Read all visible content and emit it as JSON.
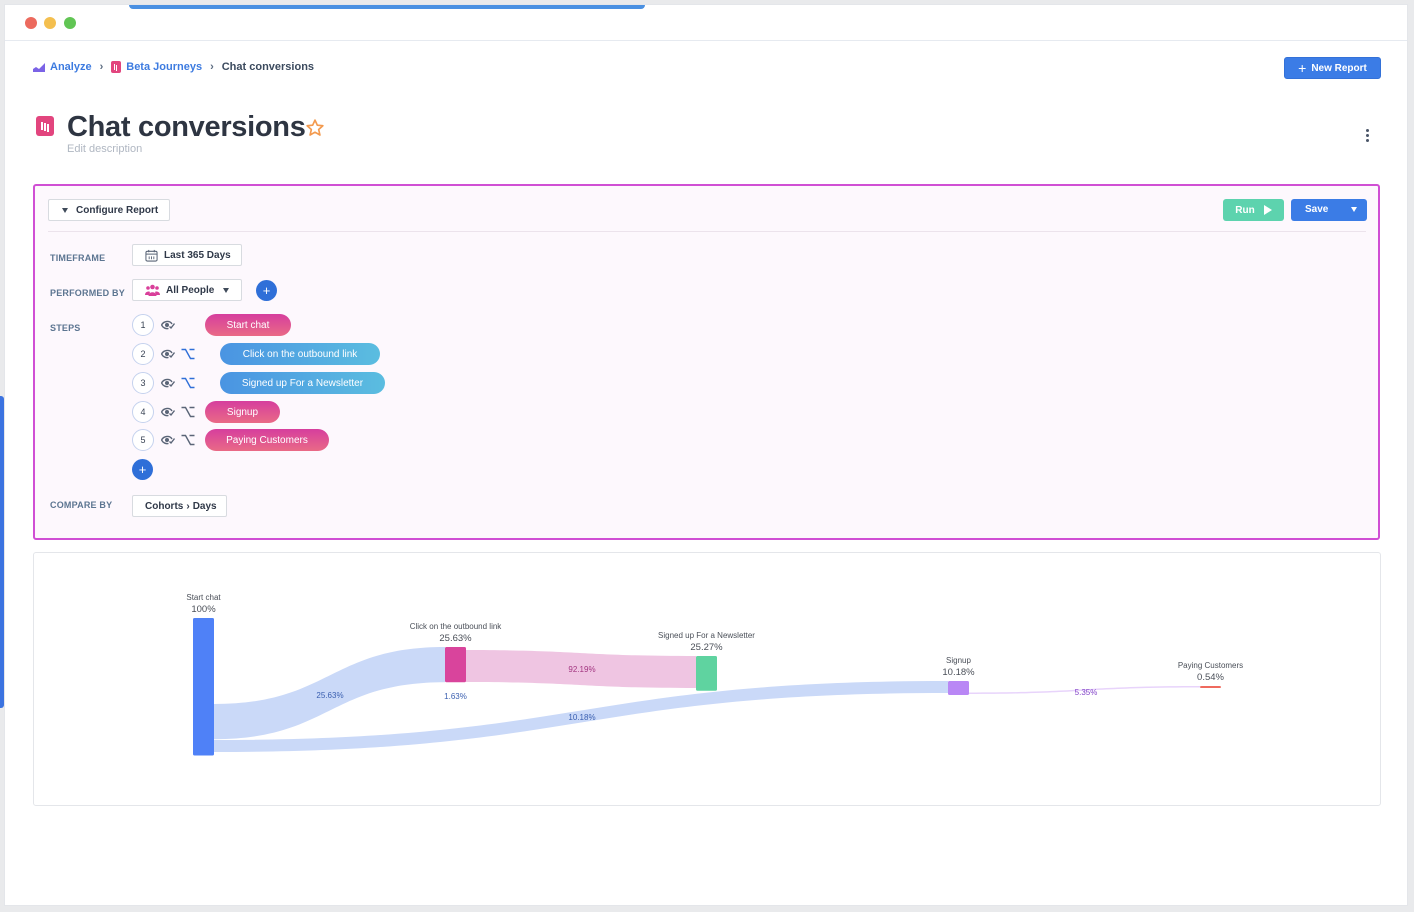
{
  "window": {
    "controls": [
      "close",
      "minimize",
      "maximize"
    ]
  },
  "breadcrumb": {
    "items": [
      {
        "label": "Analyze",
        "icon": "analyze-chart-icon"
      },
      {
        "label": "Beta Journeys",
        "icon": "journey-icon"
      },
      {
        "label": "Chat conversions"
      }
    ],
    "separator": "›"
  },
  "header": {
    "new_report_label": "New Report",
    "new_report_icon": "+",
    "title": "Chat conversions",
    "favorite_icon": "star-outline-icon",
    "description_placeholder": "Edit description",
    "more_icon": "kebab-menu-icon"
  },
  "config": {
    "toggle_label": "Configure Report",
    "run_label": "Run",
    "save_label": "Save",
    "timeframe": {
      "label": "TIMEFRAME",
      "value": "Last 365 Days"
    },
    "performed_by": {
      "label": "PERFORMED BY",
      "value": "All People",
      "add_icon": "+"
    },
    "steps_label": "STEPS",
    "steps": [
      {
        "number": "1",
        "name": "Start chat",
        "color": "pink",
        "has_branch": false
      },
      {
        "number": "2",
        "name": "Click on the outbound link",
        "color": "blue",
        "has_branch": true
      },
      {
        "number": "3",
        "name": "Signed up For a Newsletter",
        "color": "blue",
        "has_branch": true
      },
      {
        "number": "4",
        "name": "Signup",
        "color": "pink",
        "has_branch": true
      },
      {
        "number": "5",
        "name": "Paying Customers",
        "color": "pink",
        "has_branch": true
      }
    ],
    "add_step_icon": "+",
    "compare_by": {
      "label": "COMPARE BY",
      "value_part1": "Cohorts",
      "value_sep": "›",
      "value_part2": "Days"
    }
  },
  "chart_data": {
    "type": "sankey",
    "title": "",
    "nodes": [
      {
        "name": "Start chat",
        "percent_label": "100%",
        "value": 100,
        "color": "#4f81f7"
      },
      {
        "name": "Click on the outbound link",
        "percent_label": "25.63%",
        "value": 25.63,
        "color": "#d9449c"
      },
      {
        "name": "Signed up For a Newsletter",
        "percent_label": "25.27%",
        "value": 25.27,
        "color": "#5fd3a0"
      },
      {
        "name": "Signup",
        "percent_label": "10.18%",
        "value": 10.18,
        "color": "#b987f5"
      },
      {
        "name": "Paying Customers",
        "percent_label": "0.54%",
        "value": 0.54,
        "color": "#ef6a5e"
      }
    ],
    "links": [
      {
        "from": "Start chat",
        "to": "Click on the outbound link",
        "label": "25.63%",
        "color": "#cad9f8",
        "label_color": "#3a5fb0"
      },
      {
        "from": "Start chat",
        "to": "Signup",
        "label": "10.18%",
        "color": "#cad9f8",
        "label_color": "#3a5fb0"
      },
      {
        "from": "Click on the outbound link",
        "to": "Signed up For a Newsletter",
        "label": "92.19%",
        "color": "#efc5e2",
        "label_color": "#a23580"
      },
      {
        "from": "Click on the outbound link",
        "to": "Signup",
        "label": "1.63%",
        "color": "#cad9f8",
        "label_color": "#3a5fb0"
      },
      {
        "from": "Signup",
        "to": "Paying Customers",
        "label": "5.35%",
        "color": "#e8d4fb",
        "label_color": "#8344c8"
      }
    ]
  }
}
